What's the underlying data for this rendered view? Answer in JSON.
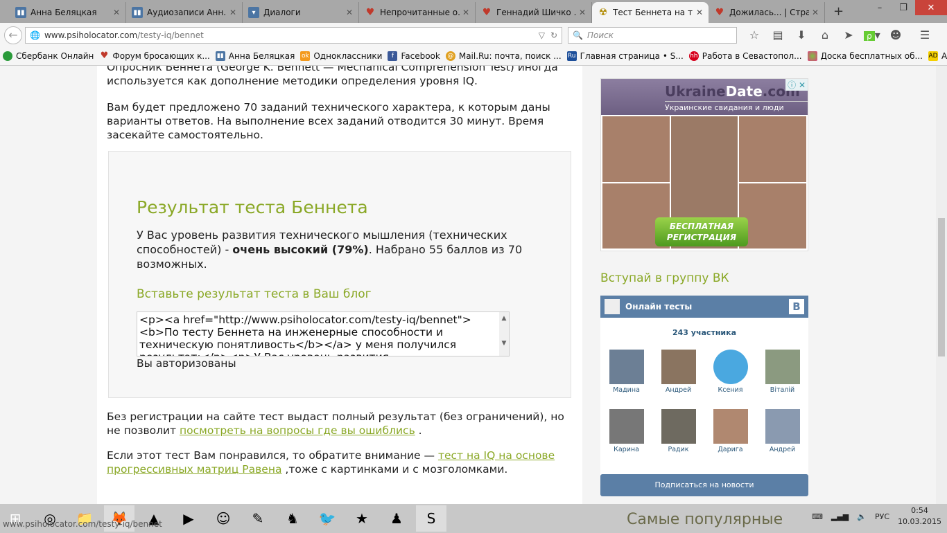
{
  "tabs": [
    {
      "label": "Анна Беляцкая",
      "icon": "vk-icon",
      "color": "#4c75a3"
    },
    {
      "label": "Аудиозаписи Анн...",
      "icon": "vk-icon",
      "color": "#4c75a3"
    },
    {
      "label": "Диалоги",
      "icon": "chat-icon",
      "color": "#4c75a3"
    },
    {
      "label": "Непрочитанные о...",
      "icon": "heart-shield-icon",
      "color": "#c0392b"
    },
    {
      "label": "Геннадий Шичко ...",
      "icon": "heart-shield-icon",
      "color": "#c0392b"
    },
    {
      "label": "Тест Беннета на т...",
      "icon": "radiation-icon",
      "color": "#d4b000",
      "active": true
    },
    {
      "label": "Дожилась... | Стра...",
      "icon": "heart-shield-icon",
      "color": "#c0392b"
    }
  ],
  "nav": {
    "url_domain": "www.psiholocator.com",
    "url_path": "/testy-iq/bennet",
    "search_placeholder": "Поиск"
  },
  "bookmarks": [
    {
      "label": "Сбербанк Онлайн",
      "color": "#2a9a3a"
    },
    {
      "label": "Форум бросающих к...",
      "color": "#c0392b"
    },
    {
      "label": "Анна Беляцкая",
      "color": "#4c75a3"
    },
    {
      "label": "Одноклассники",
      "color": "#f39a1e"
    },
    {
      "label": "Facebook",
      "color": "#3b5998"
    },
    {
      "label": "Mail.Ru: почта, поиск ...",
      "color": "#e0a020"
    },
    {
      "label": "Главная страница • S...",
      "color": "#1d4f9a"
    },
    {
      "label": "Работа в Севастопол...",
      "color": "#d6001c"
    },
    {
      "label": "Доска бесплатных об...",
      "color": "#7cc142"
    },
    {
      "label": "AdMe — Творчество. ...",
      "color": "#f5d000"
    }
  ],
  "content": {
    "intro1": "Опросник Беннета (George K. Bennett — Mechanical Comprehension Test) иногда используется как дополнение методики определения уровня IQ.",
    "intro2": "Вам будет предложено 70 заданий технического характера, к которым даны варианты ответов. На выполнение всех заданий отводится 30 минут. Время засекайте самостоятельно.",
    "result_title": "Результат теста Беннета",
    "result_pre": "У Вас уровень развития технического мышления (технических способностей) - ",
    "result_bold": "очень высокий (79%)",
    "result_post": ". Набрано 55 баллов из 70 возможных.",
    "blog_title": "Вставьте результат теста в Ваш блог",
    "blog_code": "<p><a href=\"http://www.psiholocator.com/testy-iq/bennet\"><b>По тесту Беннета на инженерные способности и техническую понятливость</b></a> у меня получился результат:</p><p>У Вас уровень развития",
    "auth": "Вы авторизованы",
    "note1_pre": "Без регистрации на сайте тест выдаст полный результат (без ограничений), но не позволит ",
    "note1_link": "посмотреть на вопросы где вы ошиблись",
    "note1_post": " .",
    "note2_pre": "Если этот тест Вам понравился, то обратите внимание — ",
    "note2_link": "тест на IQ на основе прогрессивных матриц Равена",
    "note2_post": " ,тоже с картинками и с мозголомками."
  },
  "ad": {
    "brand_a": "Ukraine",
    "brand_b": "Date",
    "brand_c": ".com",
    "slogan": "Украинские свидания и люди",
    "button": "БЕСПЛАТНАЯ РЕГИСТРАЦИЯ"
  },
  "vk": {
    "title": "Вступай в группу ВК",
    "group": "Онлайн тесты",
    "logo": "В",
    "count": "243 участника",
    "members": [
      "Мадина",
      "Андрей",
      "Ксения",
      "Віталій",
      "Карина",
      "Радик",
      "Дарига",
      "Андрей"
    ],
    "subscribe": "Подписаться на новости"
  },
  "popular": "Самые популярные",
  "taskbar": {
    "lang": "РУС",
    "time": "0:54",
    "date": "10.03.2015"
  },
  "status_url": "www.psiholocator.com/testy-iq/bennet"
}
